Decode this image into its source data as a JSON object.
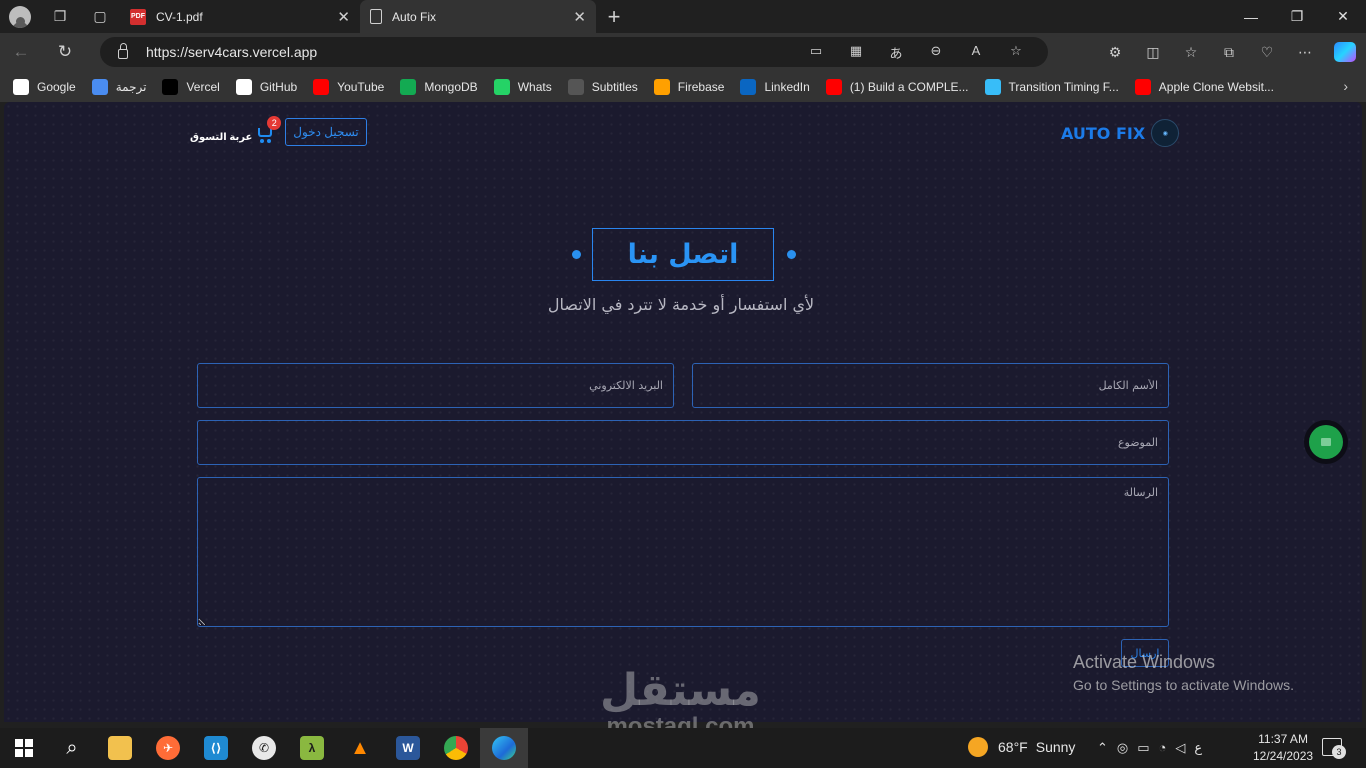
{
  "browser": {
    "tabs": [
      {
        "title": "CV-1.pdf",
        "icon": "pdf-icon",
        "active": false
      },
      {
        "title": "Auto Fix",
        "icon": "document-icon",
        "active": true
      }
    ],
    "url": "https://serv4cars.vercel.app",
    "bookmarks": [
      {
        "label": "Google",
        "icon": "google-icon",
        "color": "#ffffff"
      },
      {
        "label": "ترجمة",
        "icon": "translate-icon",
        "color": "#4a8cf0"
      },
      {
        "label": "Vercel",
        "icon": "vercel-icon",
        "color": "#000000"
      },
      {
        "label": "GitHub",
        "icon": "github-icon",
        "color": "#ffffff"
      },
      {
        "label": "YouTube",
        "icon": "youtube-icon",
        "color": "#ff0000"
      },
      {
        "label": "MongoDB",
        "icon": "mongodb-icon",
        "color": "#13aa52"
      },
      {
        "label": "Whats",
        "icon": "whatsapp-icon",
        "color": "#25d366"
      },
      {
        "label": "Subtitles",
        "icon": "subtitles-icon",
        "color": "#555555"
      },
      {
        "label": "Firebase",
        "icon": "firebase-icon",
        "color": "#ffa000"
      },
      {
        "label": "LinkedIn",
        "icon": "linkedin-icon",
        "color": "#0a66c2"
      },
      {
        "label": "(1) Build a COMPLE...",
        "icon": "youtube-icon",
        "color": "#ff0000"
      },
      {
        "label": "Transition Timing F...",
        "icon": "tailwind-icon",
        "color": "#38bdf8"
      },
      {
        "label": "Apple Clone Websit...",
        "icon": "youtube-icon",
        "color": "#ff0000"
      }
    ]
  },
  "site": {
    "logo_text": "AUTO FIX",
    "login_label": "تسجيل دخول",
    "cart_label": "عربة التسوق",
    "cart_count": "2",
    "heading": "اتصل بنا",
    "subtitle": "لأي استفسار أو خدمة لا تترد في الاتصال",
    "form": {
      "name_placeholder": "الأسم الكامل",
      "email_placeholder": "البريد الالكتروني",
      "subject_placeholder": "الموضوع",
      "message_placeholder": "الرسالة",
      "send_label": "ارسال"
    },
    "accent_color": "#2a90ee"
  },
  "overlay": {
    "activate_title": "Activate Windows",
    "activate_sub": "Go to Settings to activate Windows.",
    "watermark_ar": "مستقل",
    "watermark_en": "mostaql.com"
  },
  "taskbar": {
    "weather_temp": "68°F",
    "weather_text": "Sunny",
    "lang": "ع",
    "time": "11:37 AM",
    "date": "12/24/2023",
    "notification_count": "3"
  }
}
